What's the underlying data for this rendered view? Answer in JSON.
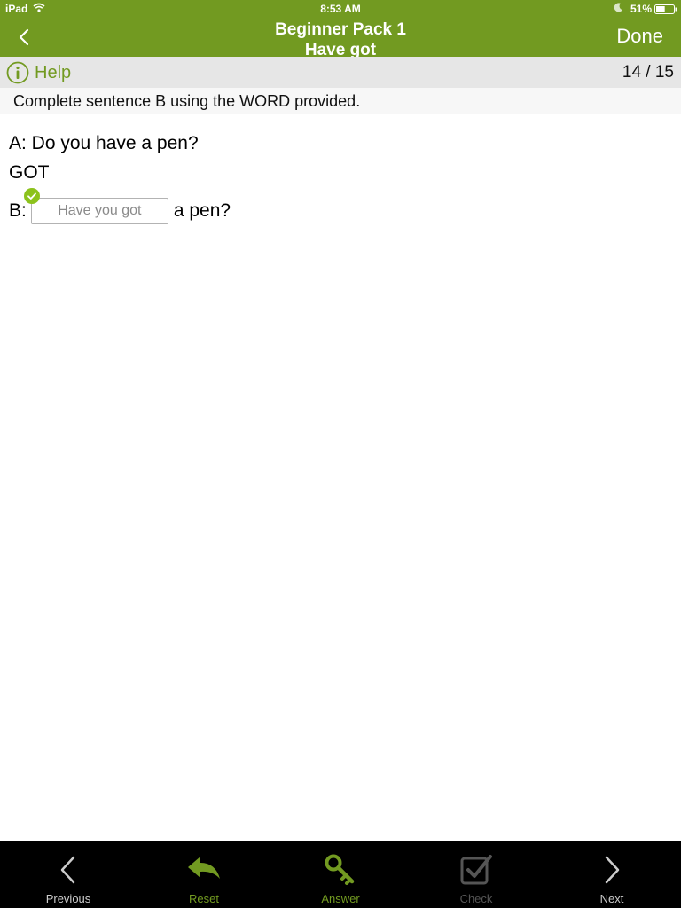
{
  "status_bar": {
    "device": "iPad",
    "time": "8:53 AM",
    "battery": "51%",
    "battery_level": 0.51
  },
  "nav": {
    "back_icon": "chevron-left-icon",
    "title_line1": "Beginner Pack 1",
    "title_line2": "Have got",
    "done_label": "Done"
  },
  "help_bar": {
    "help_label": "Help",
    "progress": "14 / 15"
  },
  "instruction": "Complete sentence B using the WORD provided.",
  "exercise": {
    "sentence_a": "A: Do you have a pen?",
    "keyword": "GOT",
    "prefix": "B:",
    "answer_value": "Have you got",
    "answer_status": "correct",
    "suffix": "a pen?"
  },
  "toolbar": {
    "items": [
      {
        "label": "Previous",
        "icon": "chevron-left-icon",
        "color": "#cccccc"
      },
      {
        "label": "Reset",
        "icon": "reply-arrow-icon",
        "color": "#729a21"
      },
      {
        "label": "Answer",
        "icon": "key-icon",
        "color": "#729a21"
      },
      {
        "label": "Check",
        "icon": "checkbox-icon",
        "color": "#555555"
      },
      {
        "label": "Next",
        "icon": "chevron-right-icon",
        "color": "#cccccc"
      }
    ]
  },
  "colors": {
    "accent": "#729a21",
    "check_badge": "#8cc21c",
    "help_bar_bg": "#e6e6e6",
    "toolbar_bg": "#000000"
  }
}
